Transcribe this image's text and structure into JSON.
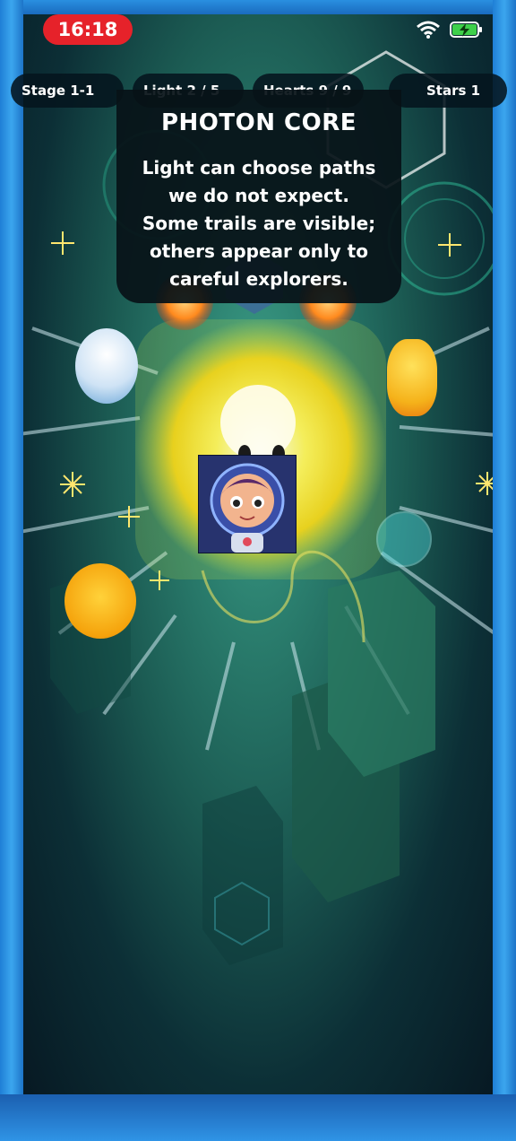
{
  "status_bar": {
    "time": "16:18",
    "icons": [
      "wifi-icon",
      "battery-charging-icon"
    ]
  },
  "hud": {
    "stage": "Stage 1-1",
    "light": "Light 2 / 5",
    "hearts": "Hearts 9 / 9",
    "stars": "Stars 1"
  },
  "dialog": {
    "title": "PHOTON CORE",
    "lines": [
      "Light can choose paths",
      "we do not expect.",
      "Some trails are visible;",
      "others appear only to",
      "careful explorers."
    ]
  },
  "colors": {
    "frame": "#2a8fe0",
    "time_pill": "#e6222a",
    "core_glow": "#ffe84a",
    "play_bg": "#1b5a52"
  }
}
